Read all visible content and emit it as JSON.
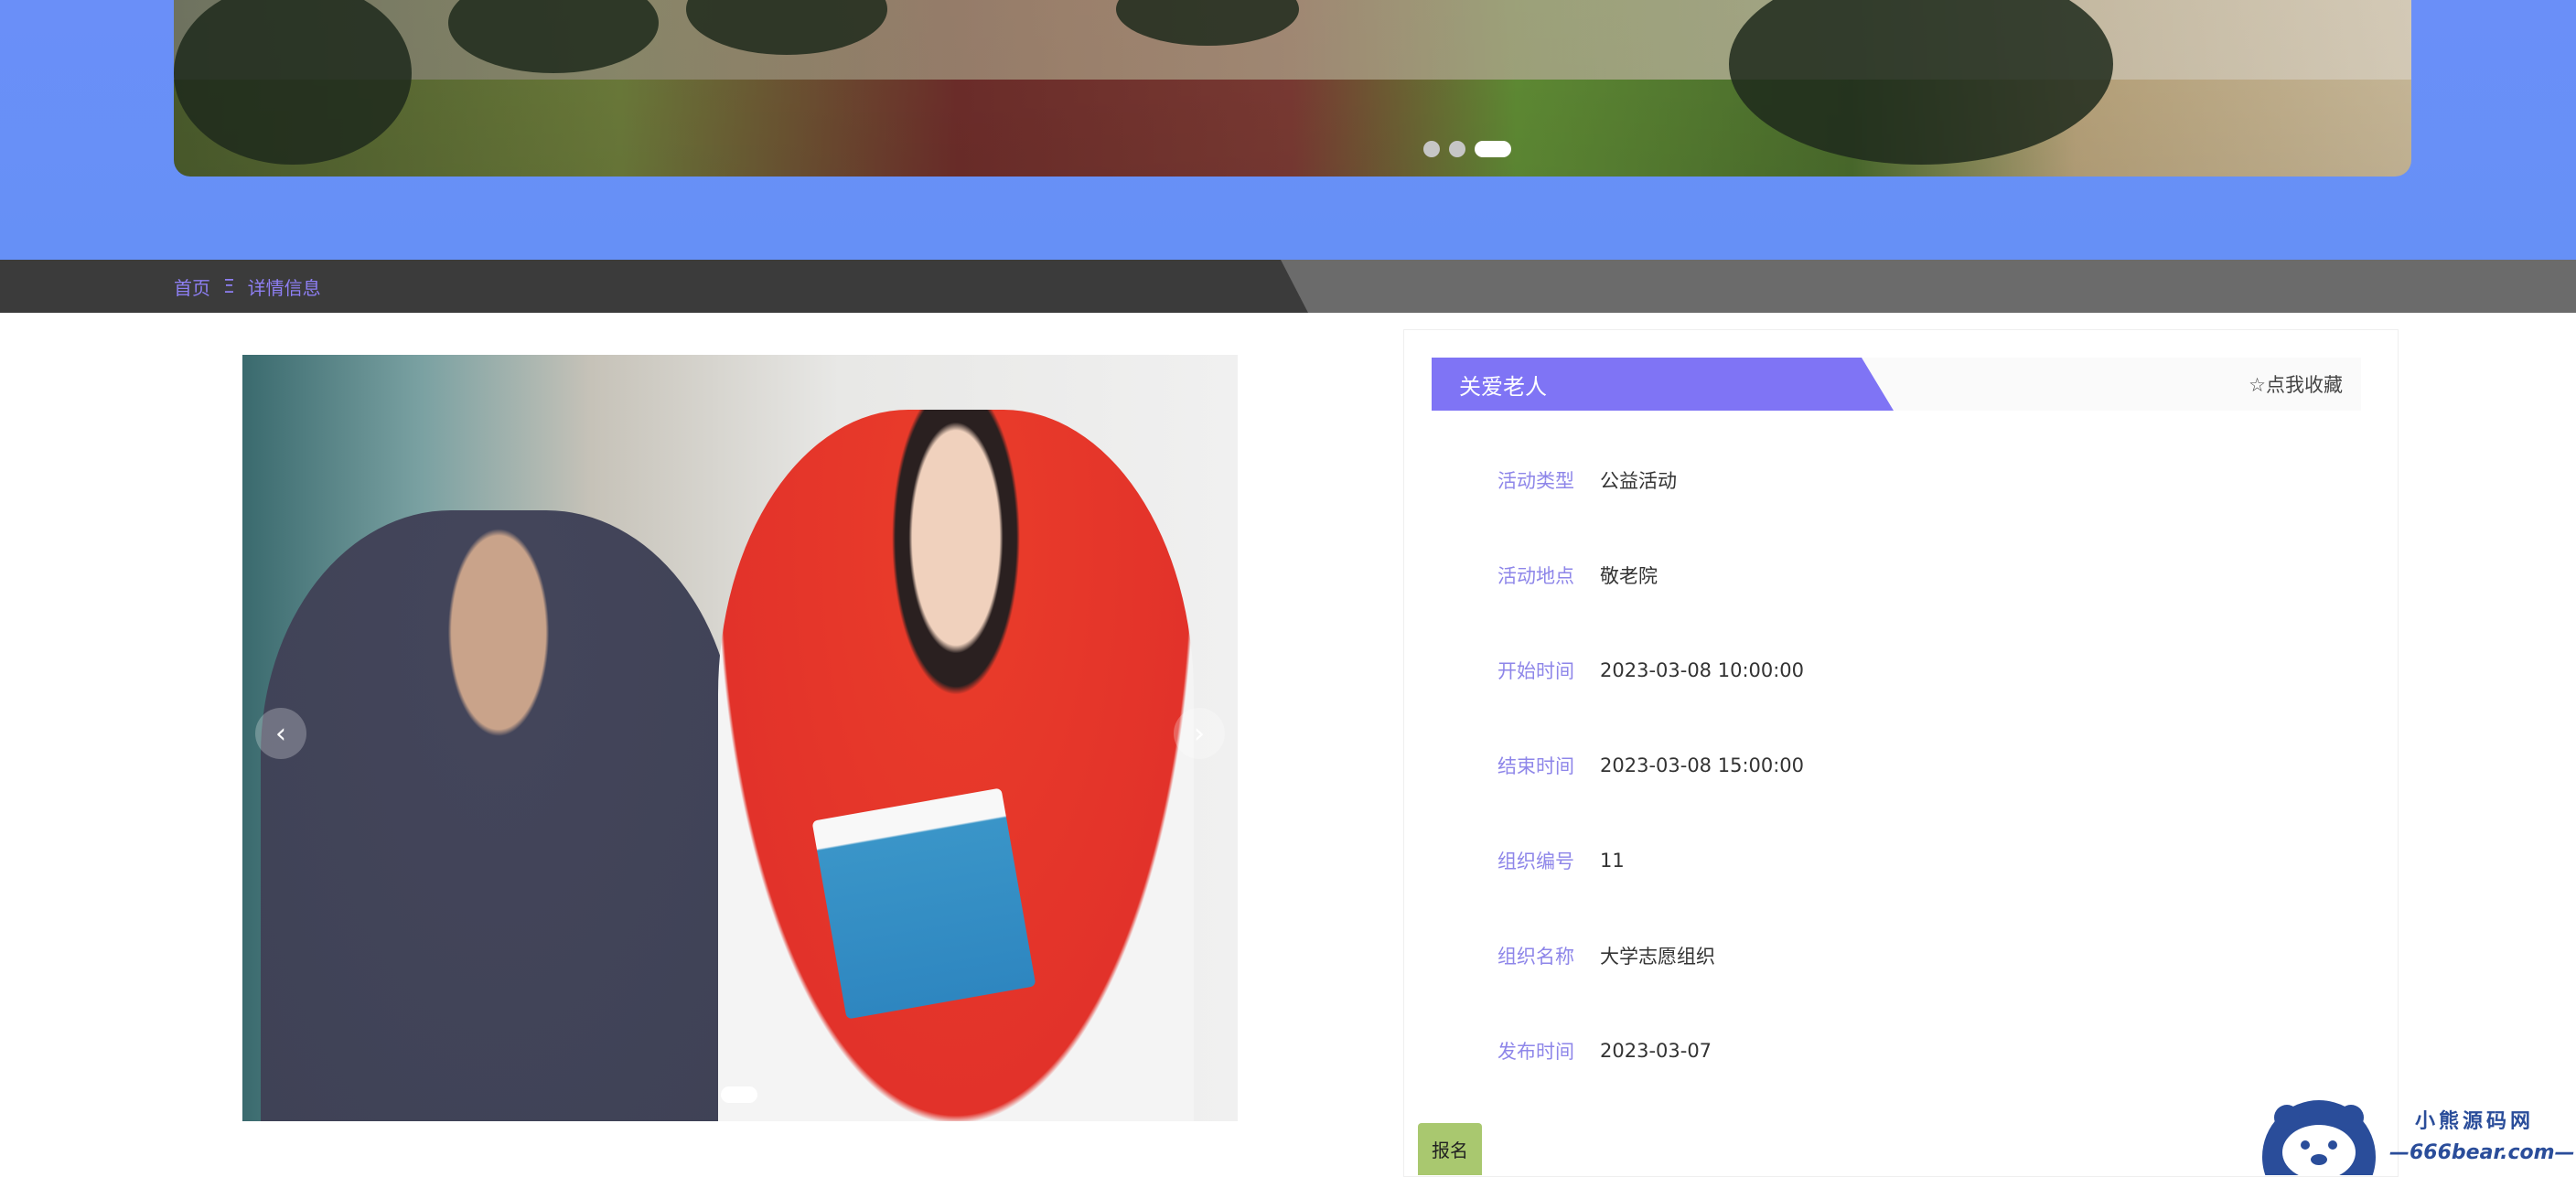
{
  "breadcrumb": {
    "home": "首页",
    "separator": "Ξ",
    "current": "详情信息"
  },
  "activity": {
    "title": "关爱老人",
    "favorite_label": "☆点我收藏",
    "fields": [
      {
        "label": "活动类型",
        "value": "公益活动"
      },
      {
        "label": "活动地点",
        "value": "敬老院"
      },
      {
        "label": "开始时间",
        "value": "2023-03-08 10:00:00"
      },
      {
        "label": "结束时间",
        "value": "2023-03-08 15:00:00"
      },
      {
        "label": "组织编号",
        "value": "11"
      },
      {
        "label": "组织名称",
        "value": "大学志愿组织"
      },
      {
        "label": "发布时间",
        "value": "2023-03-07"
      }
    ],
    "signup_label": "报名"
  },
  "gallery": {
    "prev_icon": "‹",
    "next_icon": "›"
  },
  "watermark": {
    "line1": "小熊源码网",
    "line2": "—666bear.com—"
  },
  "banner": {
    "slides": 3,
    "active_slide": 3
  },
  "colors": {
    "accent": "#7f74f5",
    "banner_blue": "#6a8ff8",
    "signup_green": "#a9c86f",
    "label_purple": "#8e86e9"
  }
}
